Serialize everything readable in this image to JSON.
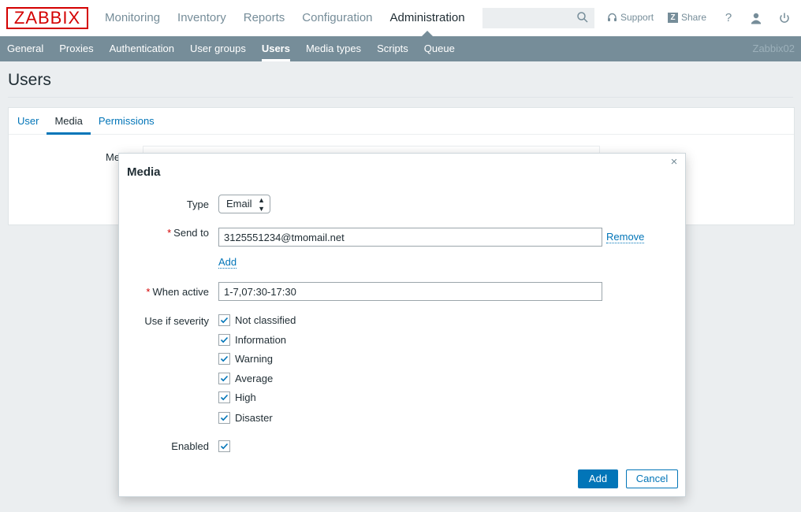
{
  "header": {
    "logo": "ZABBIX",
    "nav": [
      "Monitoring",
      "Inventory",
      "Reports",
      "Configuration",
      "Administration"
    ],
    "active_nav": "Administration",
    "search": {
      "value": "",
      "placeholder": ""
    },
    "support_label": "Support",
    "share_label": "Share",
    "help_label": "?"
  },
  "subnav": {
    "items": [
      "General",
      "Proxies",
      "Authentication",
      "User groups",
      "Users",
      "Media types",
      "Scripts",
      "Queue"
    ],
    "active": "Users",
    "server": "Zabbix02"
  },
  "page": {
    "title": "Users",
    "tabs": [
      "User",
      "Media",
      "Permissions"
    ],
    "active_tab": "Media",
    "media_label": "Me"
  },
  "dialog": {
    "title": "Media",
    "close": "×",
    "type_label": "Type",
    "type_value": "Email",
    "send_to_label": "Send to",
    "send_to_value": "3125551234@tmomail.net",
    "remove_label": "Remove",
    "add_link_label": "Add",
    "when_active_label": "When active",
    "when_active_value": "1-7,07:30-17:30",
    "severity_label": "Use if severity",
    "severities": [
      {
        "label": "Not classified",
        "checked": true
      },
      {
        "label": "Information",
        "checked": true
      },
      {
        "label": "Warning",
        "checked": true
      },
      {
        "label": "Average",
        "checked": true
      },
      {
        "label": "High",
        "checked": true
      },
      {
        "label": "Disaster",
        "checked": true
      }
    ],
    "enabled_label": "Enabled",
    "enabled_checked": true,
    "add_button": "Add",
    "cancel_button": "Cancel",
    "required_marker": "*"
  },
  "colors": {
    "brand": "#d40000",
    "accent": "#0275b8",
    "subnav_bg": "#768d99"
  }
}
